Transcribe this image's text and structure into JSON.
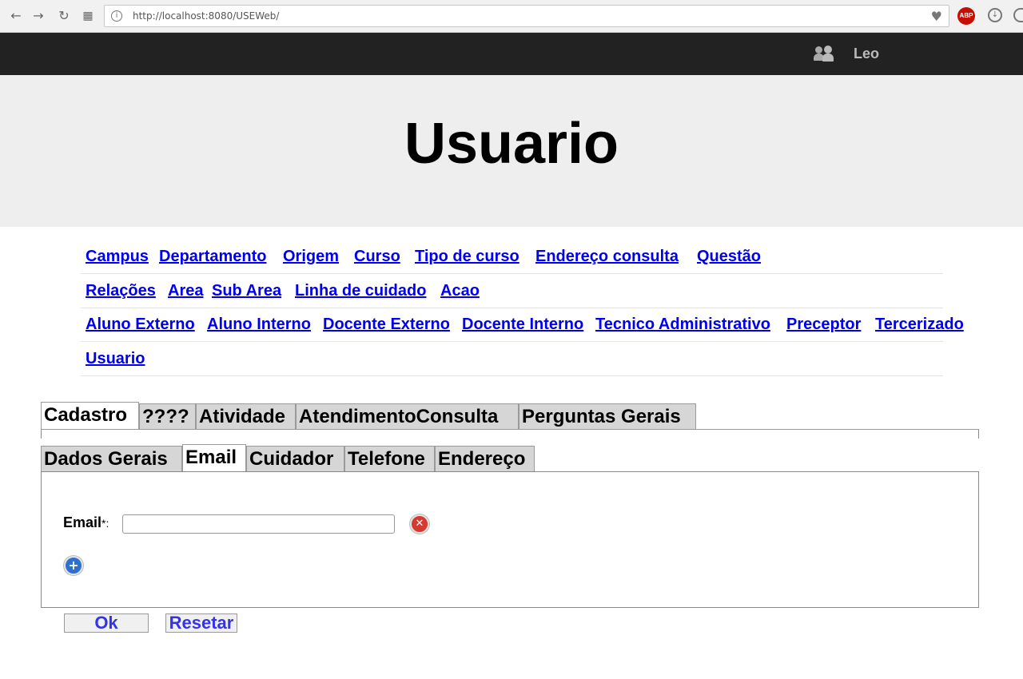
{
  "browser": {
    "url": "http://localhost:8080/USEWeb/",
    "abp_label": "ABP"
  },
  "topbar": {
    "user_name": "Leo"
  },
  "header": {
    "title": "Usuario"
  },
  "nav": {
    "rows": [
      [
        "Campus",
        "Departamento",
        "Origem",
        "Curso",
        "Tipo de curso",
        "Endereço consulta",
        "Questão"
      ],
      [
        "Relações",
        "Area",
        "Sub Area",
        "Linha de cuidado",
        "Acao"
      ],
      [
        "Aluno Externo",
        "Aluno Interno",
        "Docente Externo",
        "Docente Interno",
        "Tecnico Administrativo",
        "Preceptor",
        "Tercerizado"
      ],
      [
        "Usuario"
      ]
    ]
  },
  "tabs": {
    "main": [
      "Cadastro",
      "????",
      "Atividade",
      "AtendimentoConsulta",
      "Perguntas Gerais"
    ],
    "main_active": "Cadastro",
    "sub": [
      "Dados Gerais",
      "Email",
      "Cuidador",
      "Telefone",
      "Endereço"
    ],
    "sub_active": "Email"
  },
  "form": {
    "email_label": "Email",
    "required_mark": "*:",
    "email_value": "",
    "remove_icon": "remove-icon",
    "add_icon": "add-icon"
  },
  "buttons": {
    "ok": "Ok",
    "reset": "Resetar"
  },
  "colors": {
    "link": "#0000ee",
    "topbar": "#222222",
    "header_bg": "#eeeeee",
    "button_text": "#3333ee"
  }
}
